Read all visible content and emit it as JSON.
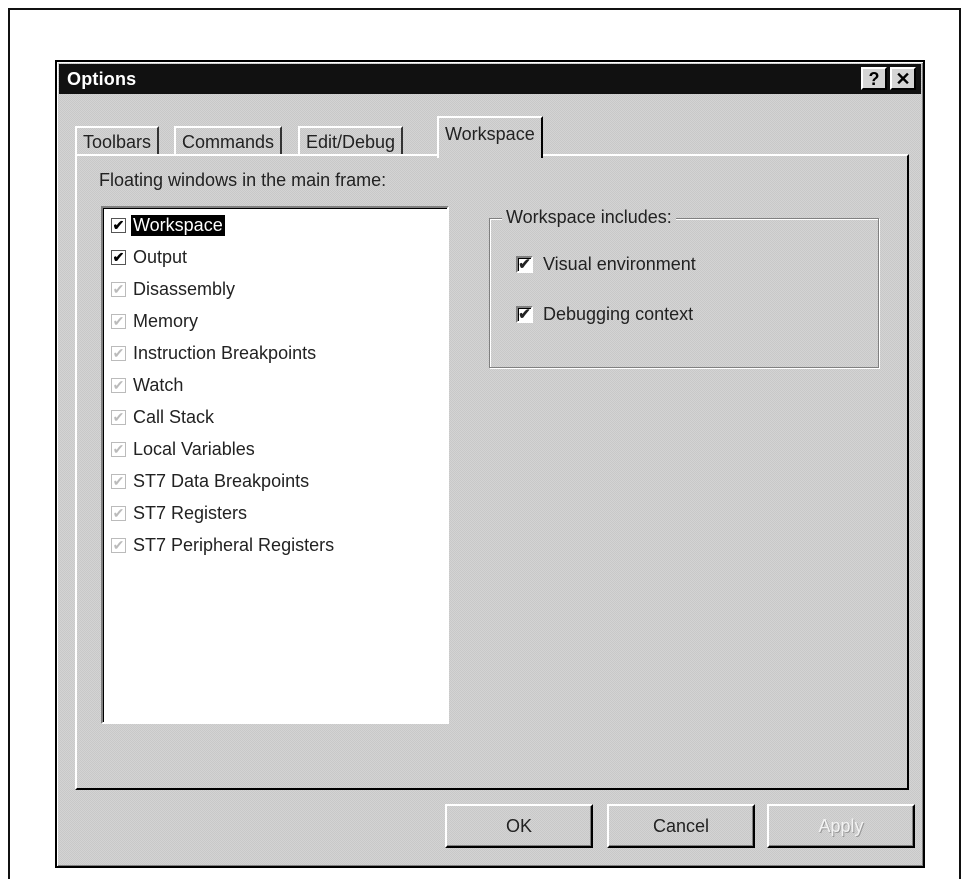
{
  "window": {
    "title": "Options",
    "help_label": "?",
    "close_label": "✕"
  },
  "tabs": [
    {
      "label": "Toolbars",
      "active": false
    },
    {
      "label": "Commands",
      "active": false
    },
    {
      "label": "Edit/Debug",
      "active": false
    },
    {
      "label": "Workspace",
      "active": true
    }
  ],
  "floating_windows": {
    "label": "Floating windows in the main frame:",
    "items": [
      {
        "label": "Workspace",
        "checked": true,
        "enabled": true,
        "selected": true
      },
      {
        "label": "Output",
        "checked": true,
        "enabled": true,
        "selected": false
      },
      {
        "label": "Disassembly",
        "checked": true,
        "enabled": false,
        "selected": false
      },
      {
        "label": "Memory",
        "checked": true,
        "enabled": false,
        "selected": false
      },
      {
        "label": "Instruction Breakpoints",
        "checked": true,
        "enabled": false,
        "selected": false
      },
      {
        "label": "Watch",
        "checked": true,
        "enabled": false,
        "selected": false
      },
      {
        "label": "Call Stack",
        "checked": true,
        "enabled": false,
        "selected": false
      },
      {
        "label": "Local Variables",
        "checked": true,
        "enabled": false,
        "selected": false
      },
      {
        "label": "ST7 Data Breakpoints",
        "checked": true,
        "enabled": false,
        "selected": false
      },
      {
        "label": "ST7 Registers",
        "checked": true,
        "enabled": false,
        "selected": false
      },
      {
        "label": "ST7 Peripheral Registers",
        "checked": true,
        "enabled": false,
        "selected": false
      }
    ]
  },
  "workspace_includes": {
    "title": "Workspace includes:",
    "items": [
      {
        "label": "Visual environment",
        "checked": true
      },
      {
        "label": "Debugging context",
        "checked": true
      }
    ]
  },
  "buttons": {
    "ok": "OK",
    "cancel": "Cancel",
    "apply": "Apply",
    "apply_enabled": false
  },
  "icons": {
    "check": "✔"
  }
}
